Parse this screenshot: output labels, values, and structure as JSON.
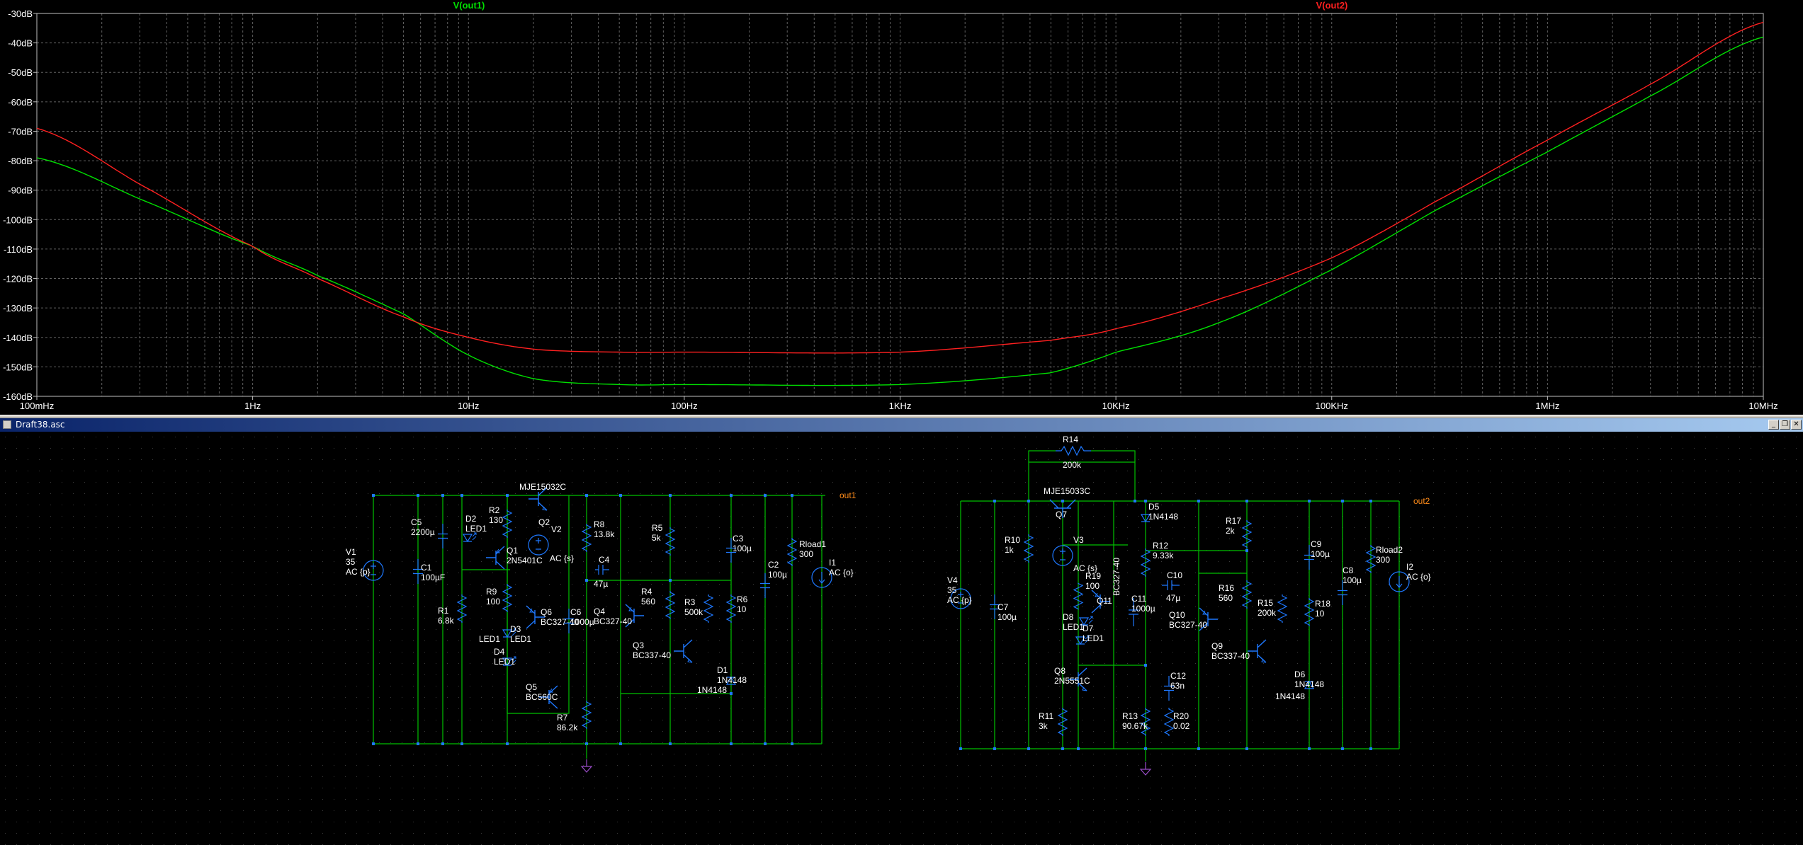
{
  "plot": {
    "traces": [
      {
        "name": "V(out1)",
        "color": "#00e000"
      },
      {
        "name": "V(out2)",
        "color": "#ff2020"
      }
    ],
    "y_ticks": [
      "-30dB",
      "-40dB",
      "-50dB",
      "-60dB",
      "-70dB",
      "-80dB",
      "-90dB",
      "-100dB",
      "-110dB",
      "-120dB",
      "-130dB",
      "-140dB",
      "-150dB",
      "-160dB"
    ],
    "x_ticks": [
      "100mHz",
      "1Hz",
      "10Hz",
      "100Hz",
      "1KHz",
      "10KHz",
      "100KHz",
      "1MHz",
      "10MHz"
    ],
    "colors": {
      "background": "#000000",
      "grid": "#606060",
      "frame": "#c0c0c0"
    }
  },
  "chart_data": {
    "type": "line",
    "title": "",
    "xlabel": "",
    "ylabel": "",
    "x_scale": "log",
    "xlim": [
      0.1,
      10000000
    ],
    "ylim": [
      -160,
      -30
    ],
    "grid": true,
    "series": [
      {
        "name": "V(out1)",
        "x": [
          0.1,
          0.3,
          1,
          2,
          5,
          10,
          20,
          50,
          100,
          1000,
          5000,
          10000,
          30000,
          100000,
          300000,
          1000000,
          3000000,
          10000000
        ],
        "y": [
          -79,
          -93,
          -109,
          -119,
          -132,
          -146,
          -154,
          -156,
          -156,
          -156,
          -152,
          -145,
          -135,
          -117,
          -97,
          -77,
          -58,
          -38
        ]
      },
      {
        "name": "V(out2)",
        "x": [
          0.1,
          0.3,
          1,
          2,
          5,
          10,
          20,
          50,
          100,
          1000,
          5000,
          10000,
          30000,
          100000,
          300000,
          1000000,
          3000000,
          10000000
        ],
        "y": [
          -69,
          -88,
          -109,
          -120,
          -133,
          -140,
          -144,
          -145,
          -145,
          -145,
          -141,
          -137,
          -127,
          -113,
          -94,
          -73,
          -54,
          -33
        ]
      }
    ]
  },
  "window": {
    "title": "Draft38.asc",
    "minimize": "_",
    "restore": "❐",
    "close": "✕"
  },
  "schematic": {
    "colors": {
      "wire": "#00c000",
      "component": "#1e78ff",
      "net": "#ff8c1a",
      "ground": "#9b4dca"
    },
    "nets": {
      "out1": "out1",
      "out2": "out2"
    },
    "left": {
      "V1": [
        "V1",
        "35",
        "AC {p}"
      ],
      "C5": [
        "C5",
        "2200µ"
      ],
      "C1": [
        "C1",
        "100µF"
      ],
      "R1": [
        "R1",
        "6.8k"
      ],
      "D2": [
        "D2",
        "LED1"
      ],
      "R2": [
        "R2",
        "130"
      ],
      "Q2": [
        "Q2",
        "MJE15032C"
      ],
      "Q1": [
        "Q1",
        "2N5401C"
      ],
      "R9": [
        "R9",
        "100"
      ],
      "D3": [
        "D3",
        "LED1"
      ],
      "D4": [
        "D4",
        "LED1"
      ],
      "Q6": [
        "Q6",
        "BC327-40"
      ],
      "C6": [
        "C6",
        "1000µ"
      ],
      "Q5": [
        "Q5",
        "BC560C"
      ],
      "R7": [
        "R7",
        "86.2k"
      ],
      "V2": [
        "V2",
        "AC {s}"
      ],
      "R8": [
        "R8",
        "13.8k"
      ],
      "C4": [
        "C4",
        "47µ"
      ],
      "R5": [
        "R5",
        "5k"
      ],
      "R4": [
        "R4",
        "560"
      ],
      "Q4": [
        "Q4",
        "BC327-40"
      ],
      "R3": [
        "R3",
        "500k"
      ],
      "Q3": [
        "Q3",
        "BC337-40"
      ],
      "C3": [
        "C3",
        "100µ"
      ],
      "R6": [
        "R6",
        "10"
      ],
      "D1": [
        "D1",
        "1N4148"
      ],
      "C2": [
        "C2",
        "100µ"
      ],
      "Rload1": [
        "Rload1",
        "300"
      ],
      "I1": [
        "I1",
        "AC {o}"
      ]
    },
    "right": {
      "R14": [
        "R14",
        "200k"
      ],
      "Q7": [
        "Q7",
        "MJE15033C"
      ],
      "D5": [
        "D5",
        "1N4148"
      ],
      "R10": [
        "R10",
        "1k"
      ],
      "V3": [
        "V3",
        "AC {s}"
      ],
      "V4": [
        "V4",
        "35",
        "AC {p}"
      ],
      "C7": [
        "C7",
        "100µ"
      ],
      "R19": [
        "R19",
        "100"
      ],
      "Q11": [
        "Q11",
        "BC327-40"
      ],
      "D8": [
        "D8",
        "LED1"
      ],
      "D7": [
        "D7",
        "LED1"
      ],
      "C11": [
        "C11",
        "1000µ"
      ],
      "R12": [
        "R12",
        "9.33k"
      ],
      "C10": [
        "C10",
        "47µ"
      ],
      "Q8": [
        "Q8",
        "2N5551C"
      ],
      "R11": [
        "R11",
        "3k"
      ],
      "R13": [
        "R13",
        "90.67k"
      ],
      "C12": [
        "C12",
        "63n"
      ],
      "R20": [
        "R20",
        "0.02"
      ],
      "R17": [
        "R17",
        "2k"
      ],
      "R16": [
        "R16",
        "560"
      ],
      "Q10": [
        "Q10",
        "BC327-40"
      ],
      "R15": [
        "R15",
        "200k"
      ],
      "Q9": [
        "Q9",
        "BC337-40"
      ],
      "C9": [
        "C9",
        "100µ"
      ],
      "R18": [
        "R18",
        "10"
      ],
      "D6": [
        "D6",
        "1N4148"
      ],
      "C8": [
        "C8",
        "100µ"
      ],
      "Rload2": [
        "Rload2",
        "300"
      ],
      "I2": [
        "I2",
        "AC {o}"
      ]
    }
  }
}
